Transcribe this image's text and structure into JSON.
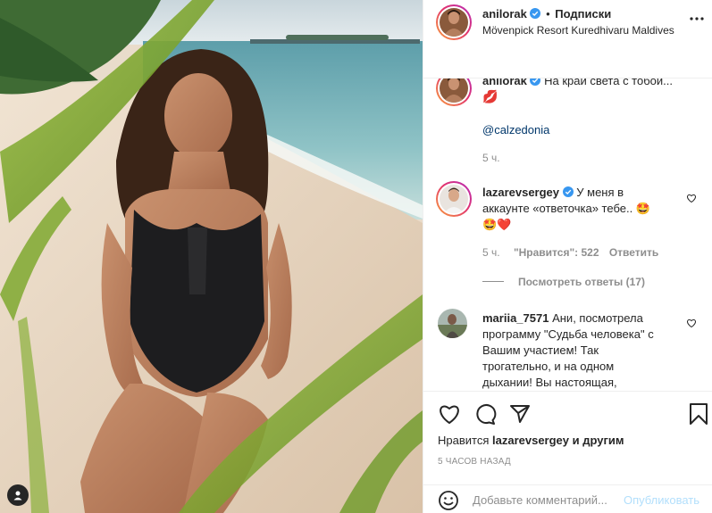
{
  "post": {
    "author": "anilorak",
    "follow_label": "Подписки",
    "separator": "•",
    "location": "Mövenpick Resort Kuredhivaru Maldives"
  },
  "caption": {
    "username": "anilorak",
    "text": "На край света с тобой...",
    "emoji": "💋",
    "mention": "@calzedonia",
    "time": "5 ч."
  },
  "comments": [
    {
      "username": "lazarevsergey",
      "text_line1": "У меня в",
      "text_line2": "аккаунте «ответочка» тебе..",
      "emoji_line2": "🤩",
      "emoji_line3": "🤩❤️",
      "time": "5 ч.",
      "likes_label": "\"Нравится\": 522",
      "reply_label": "Ответить",
      "view_replies": "Посмотреть ответы (17)"
    },
    {
      "username": "mariia_7571",
      "lines": [
        "Ани, посмотрела",
        "программу \"Судьба человека\" с",
        "Вашим участием! Так",
        "трогательно, и на одном",
        "дыхании! Вы настоящая,"
      ]
    }
  ],
  "likes": {
    "prefix": "Нравится",
    "user": "lazarevsergey",
    "suffix": "и другим"
  },
  "time_ago": "5 ЧАСОВ НАЗАД",
  "add_comment": {
    "placeholder": "Добавьте комментарий...",
    "publish_label": "Опубликовать"
  },
  "icons": {
    "verified": "verified-badge-icon",
    "more": "more-options-icon",
    "like": "heart-icon",
    "comment": "comment-icon",
    "share": "paper-plane-icon",
    "save": "bookmark-icon",
    "emoji": "smiley-icon",
    "user_tag": "user-tag-icon"
  },
  "colors": {
    "verified": "#3897f0",
    "link": "#00376b",
    "muted": "#8e8e8e",
    "publish_disabled": "#b2dffc"
  }
}
